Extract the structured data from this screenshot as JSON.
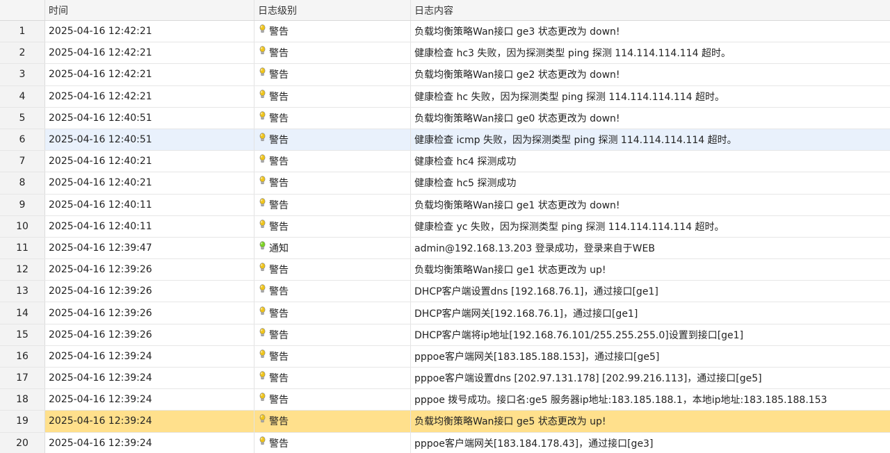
{
  "columns": {
    "index": "",
    "time": "时间",
    "level": "日志级别",
    "message": "日志内容"
  },
  "level_colors": {
    "警告": "#f0c419",
    "通知": "#7bd321"
  },
  "selected_row": 19,
  "hover_row": 6,
  "rows": [
    {
      "index": "1",
      "time": "2025-04-16 12:42:21",
      "level": "警告",
      "level_icon": "warning-bulb-icon",
      "message": "负载均衡策略Wan接口 ge3 状态更改为 down!"
    },
    {
      "index": "2",
      "time": "2025-04-16 12:42:21",
      "level": "警告",
      "level_icon": "warning-bulb-icon",
      "message": "健康检查 hc3 失败，因为探测类型 ping 探测 114.114.114.114 超时。"
    },
    {
      "index": "3",
      "time": "2025-04-16 12:42:21",
      "level": "警告",
      "level_icon": "warning-bulb-icon",
      "message": "负载均衡策略Wan接口 ge2 状态更改为 down!"
    },
    {
      "index": "4",
      "time": "2025-04-16 12:42:21",
      "level": "警告",
      "level_icon": "warning-bulb-icon",
      "message": "健康检查 hc 失败，因为探测类型 ping 探测 114.114.114.114 超时。"
    },
    {
      "index": "5",
      "time": "2025-04-16 12:40:51",
      "level": "警告",
      "level_icon": "warning-bulb-icon",
      "message": "负载均衡策略Wan接口 ge0 状态更改为 down!"
    },
    {
      "index": "6",
      "time": "2025-04-16 12:40:51",
      "level": "警告",
      "level_icon": "warning-bulb-icon",
      "message": "健康检查 icmp 失败，因为探测类型 ping 探测 114.114.114.114 超时。"
    },
    {
      "index": "7",
      "time": "2025-04-16 12:40:21",
      "level": "警告",
      "level_icon": "warning-bulb-icon",
      "message": "健康检查 hc4 探测成功"
    },
    {
      "index": "8",
      "time": "2025-04-16 12:40:21",
      "level": "警告",
      "level_icon": "warning-bulb-icon",
      "message": "健康检查 hc5 探测成功"
    },
    {
      "index": "9",
      "time": "2025-04-16 12:40:11",
      "level": "警告",
      "level_icon": "warning-bulb-icon",
      "message": "负载均衡策略Wan接口 ge1 状态更改为 down!"
    },
    {
      "index": "10",
      "time": "2025-04-16 12:40:11",
      "level": "警告",
      "level_icon": "warning-bulb-icon",
      "message": "健康检查 yc 失败，因为探测类型 ping 探测 114.114.114.114 超时。"
    },
    {
      "index": "11",
      "time": "2025-04-16 12:39:47",
      "level": "通知",
      "level_icon": "notice-bulb-icon",
      "message": "admin@192.168.13.203 登录成功，登录来自于WEB"
    },
    {
      "index": "12",
      "time": "2025-04-16 12:39:26",
      "level": "警告",
      "level_icon": "warning-bulb-icon",
      "message": "负载均衡策略Wan接口 ge1 状态更改为 up!"
    },
    {
      "index": "13",
      "time": "2025-04-16 12:39:26",
      "level": "警告",
      "level_icon": "warning-bulb-icon",
      "message": "DHCP客户端设置dns [192.168.76.1]，通过接口[ge1]"
    },
    {
      "index": "14",
      "time": "2025-04-16 12:39:26",
      "level": "警告",
      "level_icon": "warning-bulb-icon",
      "message": "DHCP客户端网关[192.168.76.1]，通过接口[ge1]"
    },
    {
      "index": "15",
      "time": "2025-04-16 12:39:26",
      "level": "警告",
      "level_icon": "warning-bulb-icon",
      "message": "DHCP客户端将ip地址[192.168.76.101/255.255.255.0]设置到接口[ge1]"
    },
    {
      "index": "16",
      "time": "2025-04-16 12:39:24",
      "level": "警告",
      "level_icon": "warning-bulb-icon",
      "message": "pppoe客户端网关[183.185.188.153]，通过接口[ge5]"
    },
    {
      "index": "17",
      "time": "2025-04-16 12:39:24",
      "level": "警告",
      "level_icon": "warning-bulb-icon",
      "message": "pppoe客户端设置dns [202.97.131.178] [202.99.216.113]，通过接口[ge5]"
    },
    {
      "index": "18",
      "time": "2025-04-16 12:39:24",
      "level": "警告",
      "level_icon": "warning-bulb-icon",
      "message": "pppoe 拨号成功。接口名:ge5 服务器ip地址:183.185.188.1，本地ip地址:183.185.188.153"
    },
    {
      "index": "19",
      "time": "2025-04-16 12:39:24",
      "level": "警告",
      "level_icon": "warning-bulb-icon",
      "message": "负载均衡策略Wan接口 ge5 状态更改为 up!"
    },
    {
      "index": "20",
      "time": "2025-04-16 12:39:24",
      "level": "警告",
      "level_icon": "warning-bulb-icon",
      "message": "pppoe客户端网关[183.184.178.43]，通过接口[ge3]"
    }
  ]
}
